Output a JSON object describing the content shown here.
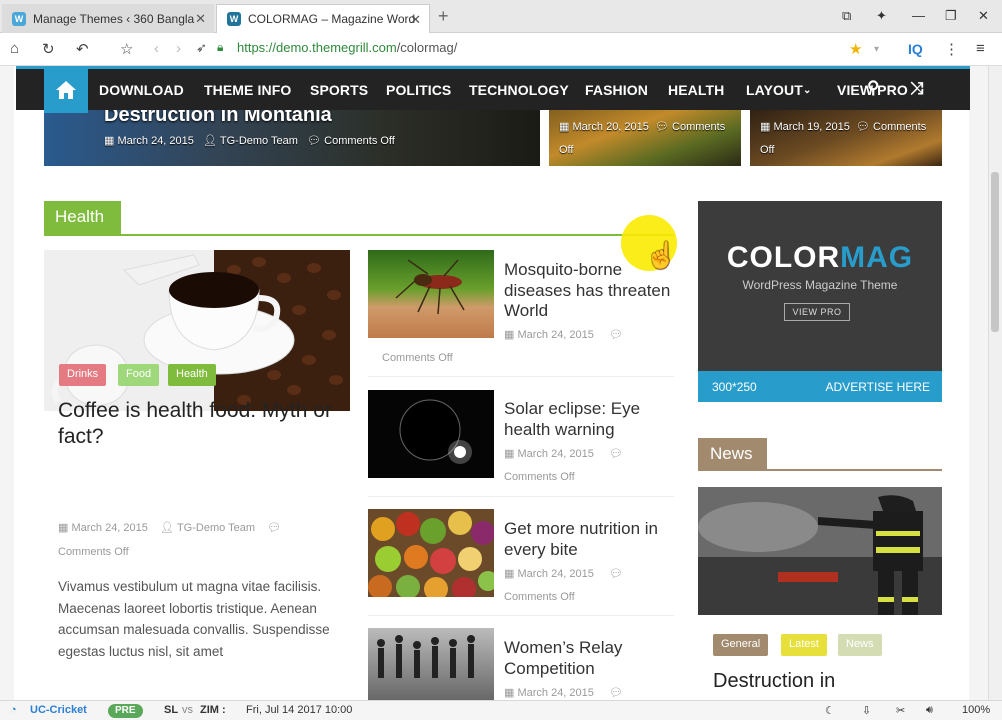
{
  "browser": {
    "tabs": [
      {
        "title": "Manage Themes ‹ 360 Bangla",
        "close": "✕"
      },
      {
        "title": "COLORMAG – Magazine Word",
        "close": "✕"
      }
    ],
    "new_tab": "+",
    "url_host": "https://demo.themegrill.com",
    "url_path": "/colormag/",
    "iq": "IQ",
    "zoom": "100%"
  },
  "nav": {
    "items": [
      "DOWNLOAD",
      "THEME INFO",
      "SPORTS",
      "POLITICS",
      "TECHNOLOGY",
      "FASHION",
      "HEALTH",
      "LAYOUT",
      "VIEW PRO"
    ]
  },
  "hero": [
    {
      "title": "Destruction in Montania",
      "date": "March 24, 2015",
      "author": "TG-Demo Team",
      "comments": "Comments Off"
    },
    {
      "date": "March 20, 2015",
      "comments": "Comments",
      "comments2": "Off"
    },
    {
      "date": "March 19, 2015",
      "comments": "Comments",
      "comments2": "Off"
    }
  ],
  "health": {
    "label": "Health",
    "featured": {
      "tags": [
        "Drinks",
        "Food",
        "Health"
      ],
      "title": "Coffee is health food: Myth or fact?",
      "date": "March 24, 2015",
      "author": "TG-Demo Team",
      "comments": "Comments Off",
      "excerpt": "Vivamus vestibulum ut magna vitae facilisis. Maecenas laoreet lobortis tristique. Aenean accumsan malesuada convallis. Suspendisse egestas luctus nisl, sit amet"
    },
    "posts": [
      {
        "title": "Mosquito-borne diseases has threaten World",
        "date": "March 24, 2015",
        "comments": "Comments Off"
      },
      {
        "title": "Solar eclipse: Eye health warning",
        "date": "March 24, 2015",
        "comments": "Comments Off"
      },
      {
        "title": "Get more nutrition in every bite",
        "date": "March 24, 2015",
        "comments": "Comments Off"
      },
      {
        "title": "Women’s Relay Competition",
        "date": "March 24, 2015"
      }
    ]
  },
  "ad": {
    "logo_a": "COLOR",
    "logo_b": "MAG",
    "subtitle": "WordPress Magazine Theme",
    "button": "VIEW PRO",
    "size": "300*250",
    "advertise": "ADVERTISE HERE"
  },
  "news": {
    "label": "News",
    "tags": [
      "General",
      "Latest",
      "News"
    ],
    "title": "Destruction in"
  },
  "statusbar": {
    "cricket": "UC-Cricket",
    "pre": "PRE",
    "team1": "SL",
    "vs": "vs",
    "team2": "ZIM :",
    "datetime": "Fri, Jul 14 2017 10:00"
  },
  "colors": {
    "accent": "#289dcc",
    "health": "#7fbb3c",
    "news": "#a28a6e",
    "nav": "#232323"
  }
}
